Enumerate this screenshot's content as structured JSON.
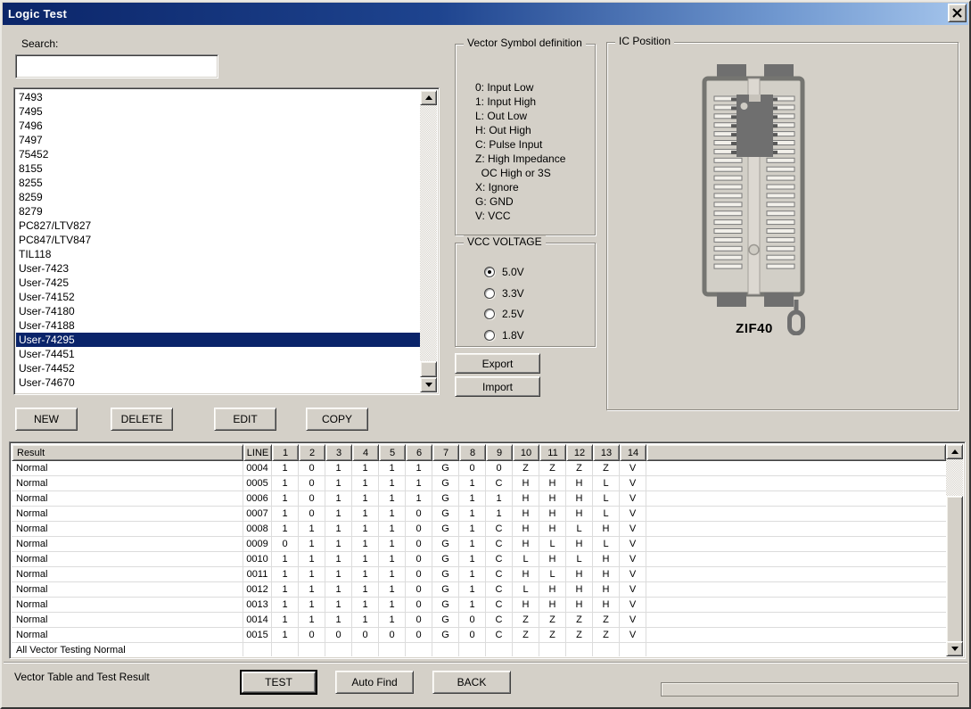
{
  "window": {
    "title": "Logic Test"
  },
  "colors": {
    "window_bg": "#d4d0c8",
    "titlebar_left": "#0b2569",
    "titlebar_right": "#a5c5ec",
    "selection_bg": "#0a246a",
    "selection_text": "#ffffff"
  },
  "search": {
    "label": "Search:",
    "value": ""
  },
  "device_list": {
    "items": [
      "7493",
      "7495",
      "7496",
      "7497",
      "75452",
      "8155",
      "8255",
      "8259",
      "8279",
      "PC827/LTV827",
      "PC847/LTV847",
      "TIL118",
      "User-7423",
      "User-7425",
      "User-74152",
      "User-74180",
      "User-74188",
      "User-74295",
      "User-74451",
      "User-74452",
      "User-74670"
    ],
    "selected": "User-74295"
  },
  "action_buttons": {
    "new": "NEW",
    "delete": "DELETE",
    "edit": "EDIT",
    "copy": "COPY"
  },
  "vector_symbols": {
    "title": "Vector Symbol definition",
    "lines": [
      "0: Input Low",
      "1: Input High",
      "L: Out Low",
      "H: Out High",
      "C: Pulse Input",
      "Z: High Impedance",
      "  OC High or 3S",
      "X: Ignore",
      "G: GND",
      "V: VCC"
    ]
  },
  "vcc_voltage": {
    "title": "VCC VOLTAGE",
    "options": [
      {
        "label": "5.0V",
        "selected": true
      },
      {
        "label": "3.3V",
        "selected": false
      },
      {
        "label": "2.5V",
        "selected": false
      },
      {
        "label": "1.8V",
        "selected": false
      }
    ]
  },
  "io_buttons": {
    "export": "Export",
    "import": "Import"
  },
  "ic_position": {
    "title": "IC Position",
    "socket_label": "ZIF40"
  },
  "result_table": {
    "columns": [
      "Result",
      "LINE",
      "1",
      "2",
      "3",
      "4",
      "5",
      "6",
      "7",
      "8",
      "9",
      "10",
      "11",
      "12",
      "13",
      "14"
    ],
    "rows": [
      {
        "result": "Normal",
        "line": "0004",
        "values": [
          "1",
          "0",
          "1",
          "1",
          "1",
          "1",
          "G",
          "0",
          "0",
          "Z",
          "Z",
          "Z",
          "Z",
          "V"
        ]
      },
      {
        "result": "Normal",
        "line": "0005",
        "values": [
          "1",
          "0",
          "1",
          "1",
          "1",
          "1",
          "G",
          "1",
          "C",
          "H",
          "H",
          "H",
          "L",
          "V"
        ]
      },
      {
        "result": "Normal",
        "line": "0006",
        "values": [
          "1",
          "0",
          "1",
          "1",
          "1",
          "1",
          "G",
          "1",
          "1",
          "H",
          "H",
          "H",
          "L",
          "V"
        ]
      },
      {
        "result": "Normal",
        "line": "0007",
        "values": [
          "1",
          "0",
          "1",
          "1",
          "1",
          "0",
          "G",
          "1",
          "1",
          "H",
          "H",
          "H",
          "L",
          "V"
        ]
      },
      {
        "result": "Normal",
        "line": "0008",
        "values": [
          "1",
          "1",
          "1",
          "1",
          "1",
          "0",
          "G",
          "1",
          "C",
          "H",
          "H",
          "L",
          "H",
          "V"
        ]
      },
      {
        "result": "Normal",
        "line": "0009",
        "values": [
          "0",
          "1",
          "1",
          "1",
          "1",
          "0",
          "G",
          "1",
          "C",
          "H",
          "L",
          "H",
          "L",
          "V"
        ]
      },
      {
        "result": "Normal",
        "line": "0010",
        "values": [
          "1",
          "1",
          "1",
          "1",
          "1",
          "0",
          "G",
          "1",
          "C",
          "L",
          "H",
          "L",
          "H",
          "V"
        ]
      },
      {
        "result": "Normal",
        "line": "0011",
        "values": [
          "1",
          "1",
          "1",
          "1",
          "1",
          "0",
          "G",
          "1",
          "C",
          "H",
          "L",
          "H",
          "H",
          "V"
        ]
      },
      {
        "result": "Normal",
        "line": "0012",
        "values": [
          "1",
          "1",
          "1",
          "1",
          "1",
          "0",
          "G",
          "1",
          "C",
          "L",
          "H",
          "H",
          "H",
          "V"
        ]
      },
      {
        "result": "Normal",
        "line": "0013",
        "values": [
          "1",
          "1",
          "1",
          "1",
          "1",
          "0",
          "G",
          "1",
          "C",
          "H",
          "H",
          "H",
          "H",
          "V"
        ]
      },
      {
        "result": "Normal",
        "line": "0014",
        "values": [
          "1",
          "1",
          "1",
          "1",
          "1",
          "0",
          "G",
          "0",
          "C",
          "Z",
          "Z",
          "Z",
          "Z",
          "V"
        ]
      },
      {
        "result": "Normal",
        "line": "0015",
        "values": [
          "1",
          "0",
          "0",
          "0",
          "0",
          "0",
          "G",
          "0",
          "C",
          "Z",
          "Z",
          "Z",
          "Z",
          "V"
        ]
      }
    ],
    "footer_row": "All Vector Testing Normal"
  },
  "bottom": {
    "label": "Vector Table and Test Result",
    "test": "TEST",
    "auto_find": "Auto Find",
    "back": "BACK"
  }
}
